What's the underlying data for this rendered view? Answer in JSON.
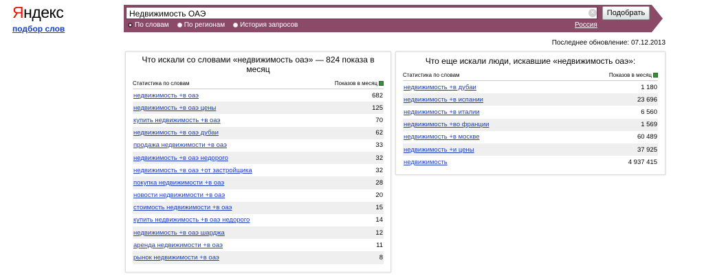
{
  "logo": {
    "first_letter": "Я",
    "rest": "ндекс"
  },
  "sublink": "подбор слов",
  "search": {
    "query": "Недвижимость ОАЭ",
    "button": "Подобрать",
    "clear": "×"
  },
  "tabs": [
    "По словам",
    "По регионам",
    "История запросов"
  ],
  "region": "Россия",
  "updated": "Последнее обновление: 07.12.2013",
  "left_panel": {
    "title": "Что искали со словами «недвижимость оаэ» — 824 показа в месяц",
    "col1": "Статистика по словам",
    "col2": "Показов в месяц",
    "rows": [
      {
        "kw": "недвижимость +в оаэ",
        "n": "682"
      },
      {
        "kw": "недвижимость +в оаэ цены",
        "n": "125"
      },
      {
        "kw": "купить недвижимость +в оаэ",
        "n": "70"
      },
      {
        "kw": "недвижимость +в оаэ дубаи",
        "n": "62"
      },
      {
        "kw": "продажа недвижимости +в оаэ",
        "n": "33"
      },
      {
        "kw": "недвижимость +в оаэ недорого",
        "n": "32"
      },
      {
        "kw": "недвижимость +в оаэ +от застройщика",
        "n": "32"
      },
      {
        "kw": "покупка недвижимости +в оаэ",
        "n": "28"
      },
      {
        "kw": "новости недвижимости +в оаэ",
        "n": "20"
      },
      {
        "kw": "стоимость недвижимости +в оаэ",
        "n": "15"
      },
      {
        "kw": "купить недвижимость +в оаэ недорого",
        "n": "14"
      },
      {
        "kw": "недвижимость +в оаэ шарджа",
        "n": "12"
      },
      {
        "kw": "аренда недвижимости +в оаэ",
        "n": "11"
      },
      {
        "kw": "рынок недвижимости +в оаэ",
        "n": "8"
      }
    ]
  },
  "right_panel": {
    "title": "Что еще искали люди, искавшие «недвижимость оаэ»:",
    "col1": "Статистика по словам",
    "col2": "Показов в месяц",
    "rows": [
      {
        "kw": "недвижимость +в дубаи",
        "n": "1 180"
      },
      {
        "kw": "недвижимость +в испании",
        "n": "23 696"
      },
      {
        "kw": "недвижимость +в италии",
        "n": "6 560"
      },
      {
        "kw": "недвижимость +во франции",
        "n": "1 569"
      },
      {
        "kw": "недвижимость +в москве",
        "n": "60 489"
      },
      {
        "kw": "недвижимость +и цены",
        "n": "37 925"
      },
      {
        "kw": "недвижимость",
        "n": "4 937 415"
      }
    ]
  },
  "icons": {
    "clear": "clear-icon",
    "export": "excel-icon"
  },
  "colors": {
    "accent": "#8b4b68",
    "link": "#1a3dc1",
    "logo_red": "#e61400"
  }
}
